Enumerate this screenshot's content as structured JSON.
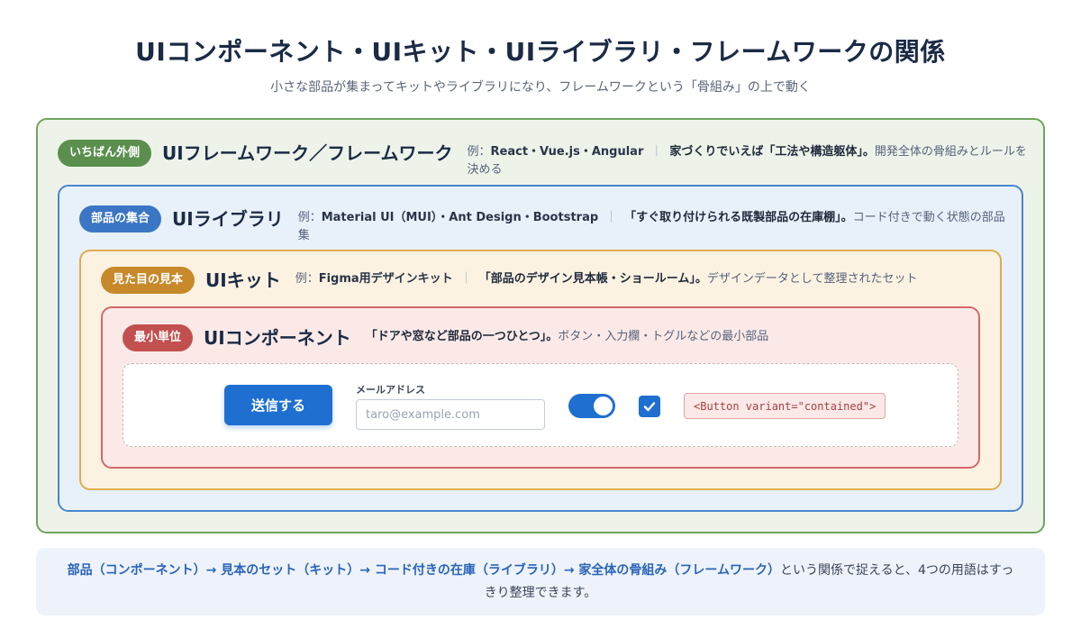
{
  "header": {
    "title": "UIコンポーネント・UIキット・UIライブラリ・フレームワークの関係",
    "subtitle": "小さな部品が集まってキットやライブラリになり、フレームワークという「骨組み」の上で動く"
  },
  "layers": {
    "framework": {
      "badge": "いちばん外側",
      "title": "UIフレームワーク／フレームワーク",
      "example_prefix": "例：",
      "example": "React・Vue.js・Angular",
      "separator": "｜",
      "highlight": "家づくりでいえば「工法や構造躯体」。",
      "detail": "開発全体の骨組みとルールを決める"
    },
    "library": {
      "badge": "部品の集合",
      "title": "UIライブラリ",
      "example_prefix": "例：",
      "example": "Material UI（MUI）・Ant Design・Bootstrap",
      "separator": "｜",
      "highlight": "「すぐ取り付けられる既製部品の在庫棚」。",
      "detail": "コード付きで動く状態の部品集"
    },
    "kit": {
      "badge": "見た目の見本",
      "title": "UIキット",
      "example_prefix": "例：",
      "example": "Figma用デザインキット",
      "separator": "｜",
      "highlight": "「部品のデザイン見本帳・ショールーム」。",
      "detail": "デザインデータとして整理されたセット"
    },
    "component": {
      "badge": "最小単位",
      "title": "UIコンポーネント",
      "highlight": "「ドアや窓など部品の一つひとつ」。",
      "detail": "ボタン・入力欄・トグルなどの最小部品"
    }
  },
  "demo": {
    "button_label": "送信する",
    "email_label": "メールアドレス",
    "email_placeholder": "taro@example.com",
    "email_value": "",
    "toggle_state": "on",
    "checkbox_state": "checked",
    "code_snippet": "<Button variant=\"contained\">"
  },
  "footer": {
    "flow": "部品（コンポーネント）→ 見本のセット（キット）→ コード付きの在庫（ライブラリ）→ 家全体の骨組み（フレームワーク）",
    "conclusion": "という関係で捉えると、4つの用語はすっきり整理できます。"
  },
  "colors": {
    "framework_border": "#6fa55e",
    "library_border": "#4a86cf",
    "kit_border": "#deac4e",
    "component_border": "#d4686a",
    "primary": "#1f6fd1"
  }
}
